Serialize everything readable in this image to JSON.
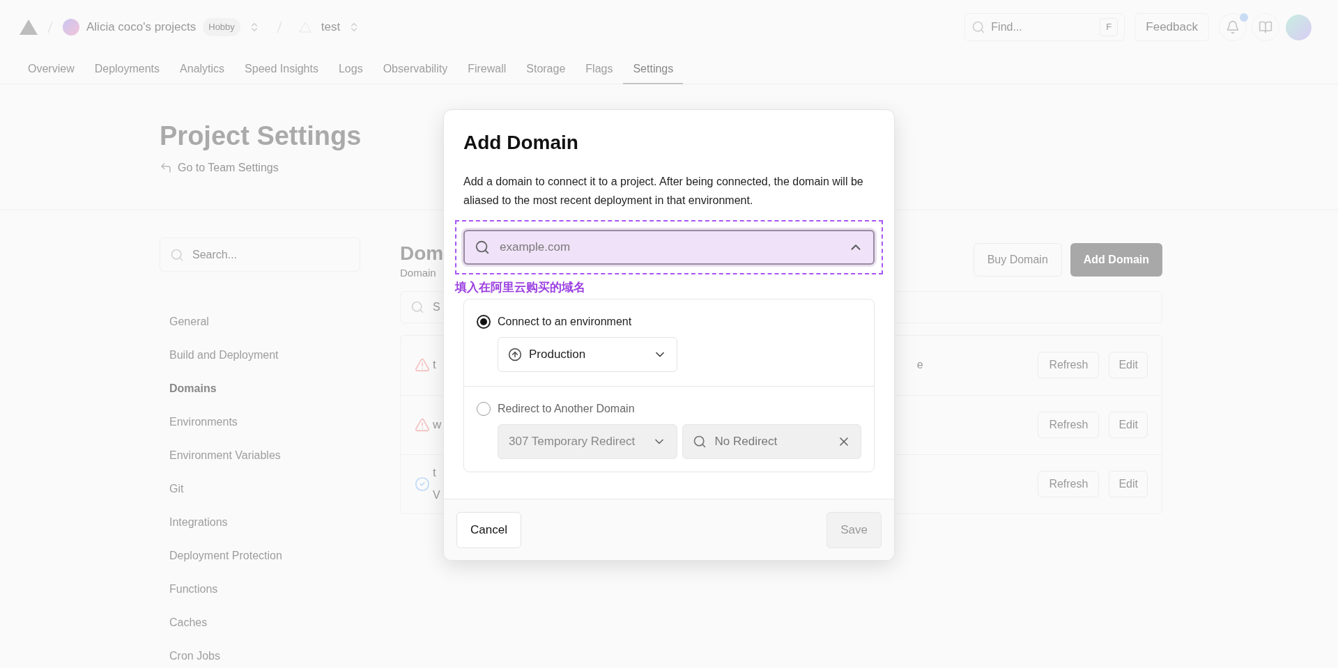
{
  "header": {
    "project": "Alicia coco's projects",
    "plan": "Hobby",
    "repo": "test",
    "search_placeholder": "Find...",
    "search_key": "F",
    "feedback": "Feedback",
    "has_notification": true
  },
  "tabs": [
    {
      "label": "Overview",
      "selected": false
    },
    {
      "label": "Deployments",
      "selected": false
    },
    {
      "label": "Analytics",
      "selected": false
    },
    {
      "label": "Speed Insights",
      "selected": false
    },
    {
      "label": "Logs",
      "selected": false
    },
    {
      "label": "Observability",
      "selected": false
    },
    {
      "label": "Firewall",
      "selected": false
    },
    {
      "label": "Storage",
      "selected": false
    },
    {
      "label": "Flags",
      "selected": false
    },
    {
      "label": "Settings",
      "selected": true
    }
  ],
  "page": {
    "title": "Project Settings",
    "back_link": "Go to Team Settings"
  },
  "sidebar": {
    "search_placeholder": "Search...",
    "items": [
      {
        "label": "General",
        "selected": false
      },
      {
        "label": "Build and Deployment",
        "selected": false
      },
      {
        "label": "Domains",
        "selected": true
      },
      {
        "label": "Environments",
        "selected": false
      },
      {
        "label": "Environment Variables",
        "selected": false
      },
      {
        "label": "Git",
        "selected": false
      },
      {
        "label": "Integrations",
        "selected": false
      },
      {
        "label": "Deployment Protection",
        "selected": false
      },
      {
        "label": "Functions",
        "selected": false
      },
      {
        "label": "Caches",
        "selected": false
      },
      {
        "label": "Cron Jobs",
        "selected": false
      }
    ]
  },
  "domains": {
    "heading": "Dom",
    "subtitle": "Domain",
    "search_placeholder": "S",
    "buy_button": "Buy Domain",
    "add_button": "Add Domain",
    "rows": [
      {
        "kind": "warning",
        "name": "t",
        "trailing": "e",
        "refresh": "Refresh",
        "edit": "Edit"
      },
      {
        "kind": "warning",
        "name": "w",
        "refresh": "Refresh",
        "edit": "Edit"
      },
      {
        "kind": "valid",
        "name": "t",
        "detail": "V",
        "refresh": "Refresh",
        "edit": "Edit"
      }
    ]
  },
  "modal": {
    "title": "Add Domain",
    "description": "Add a domain to connect it to a project. After being connected, the domain will be aliased to the most recent deployment in that environment.",
    "input": {
      "placeholder": "example.com"
    },
    "annotation": "填入在阿里云购买的域名",
    "options": [
      {
        "kind": "environment",
        "label": "Connect to an environment",
        "selected": true,
        "environment": "Production"
      },
      {
        "kind": "redirect",
        "label": "Redirect to Another Domain",
        "selected": false,
        "status_code": "307 Temporary Redirect",
        "target_placeholder": "No Redirect"
      }
    ],
    "cancel": "Cancel",
    "save": "Save",
    "save_disabled": true
  }
}
